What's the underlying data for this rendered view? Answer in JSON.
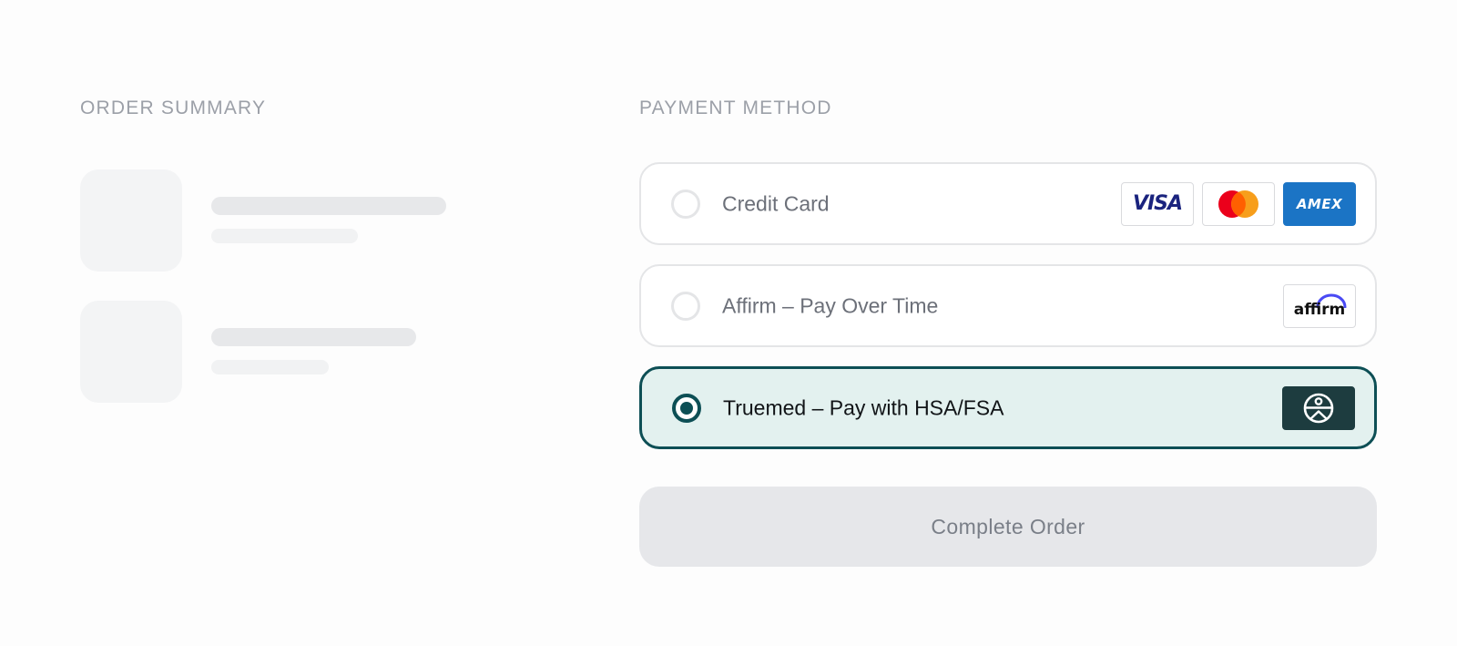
{
  "order_summary": {
    "heading": "ORDER SUMMARY"
  },
  "payment": {
    "heading": "PAYMENT METHOD",
    "options": [
      {
        "label": "Credit Card",
        "selected": false,
        "badges": [
          {
            "name": "visa-logo",
            "text": "VISA"
          },
          {
            "name": "mastercard-logo"
          },
          {
            "name": "amex-logo",
            "text": "AMEX"
          }
        ]
      },
      {
        "label": "Affirm – Pay Over Time",
        "selected": false,
        "badges": [
          {
            "name": "affirm-logo",
            "text": "affirm"
          }
        ]
      },
      {
        "label": "Truemed – Pay with HSA/FSA",
        "selected": true,
        "badges": [
          {
            "name": "truemed-logo"
          }
        ]
      }
    ]
  },
  "actions": {
    "complete_label": "Complete Order"
  },
  "colors": {
    "accent": "#0d4f55",
    "selected_background": "#e3f1ef",
    "amex_blue": "#1b74c5",
    "mastercard_red": "#eb001b",
    "mastercard_orange": "#f79e1b",
    "affirm_arc": "#4a4af4",
    "truemed_badge": "#1d3c3f"
  }
}
